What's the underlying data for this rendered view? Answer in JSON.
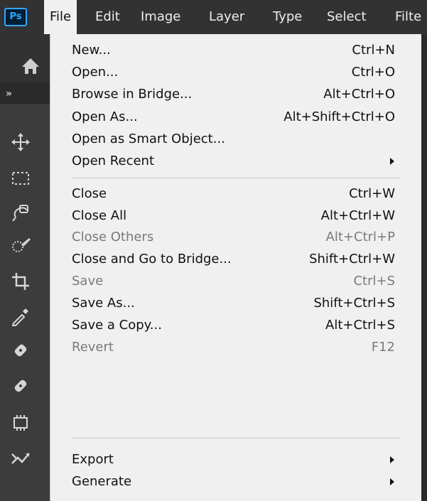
{
  "app": {
    "logo_text": "Ps"
  },
  "menubar": {
    "items": [
      {
        "label": "File",
        "active": true
      },
      {
        "label": "Edit"
      },
      {
        "label": "Image"
      },
      {
        "label": "Layer"
      },
      {
        "label": "Type"
      },
      {
        "label": "Select"
      },
      {
        "label": "Filte"
      }
    ]
  },
  "tools": {
    "collapse_label": "»",
    "icons": [
      "move-icon",
      "marquee-icon",
      "object-select-icon",
      "quick-select-icon",
      "crop-icon",
      "eyedropper-icon",
      "spot-healing-icon",
      "healing-brush-icon",
      "patch-icon",
      "content-aware-move-icon"
    ]
  },
  "file_menu": {
    "items": [
      {
        "label": "New...",
        "shortcut": "Ctrl+N"
      },
      {
        "label": "Open...",
        "shortcut": "Ctrl+O"
      },
      {
        "label": "Browse in Bridge...",
        "shortcut": "Alt+Ctrl+O"
      },
      {
        "label": "Open As...",
        "shortcut": "Alt+Shift+Ctrl+O"
      },
      {
        "label": "Open as Smart Object...",
        "shortcut": ""
      },
      {
        "label": "Open Recent",
        "shortcut": "",
        "submenu": true
      },
      {
        "label": "Close",
        "shortcut": "Ctrl+W"
      },
      {
        "label": "Close All",
        "shortcut": "Alt+Ctrl+W"
      },
      {
        "label": "Close Others",
        "shortcut": "Alt+Ctrl+P",
        "disabled": true
      },
      {
        "label": "Close and Go to Bridge...",
        "shortcut": "Shift+Ctrl+W"
      },
      {
        "label": "Save",
        "shortcut": "Ctrl+S",
        "disabled": true
      },
      {
        "label": "Save As...",
        "shortcut": "Shift+Ctrl+S"
      },
      {
        "label": "Save a Copy...",
        "shortcut": "Alt+Ctrl+S"
      },
      {
        "label": "Revert",
        "shortcut": "F12",
        "disabled": true
      },
      {
        "label": "Export",
        "shortcut": "",
        "submenu": true
      },
      {
        "label": "Generate",
        "shortcut": "",
        "submenu": true
      }
    ]
  }
}
